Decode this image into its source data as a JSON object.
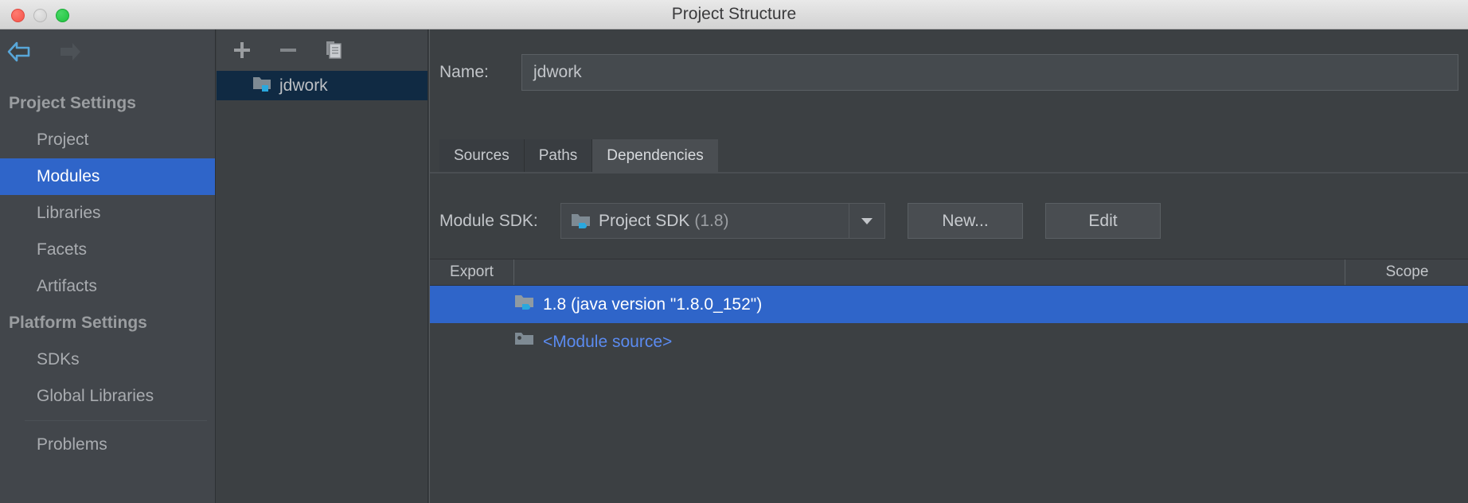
{
  "window": {
    "title": "Project Structure",
    "traffic_lights": [
      "close-button",
      "minimize-button",
      "maximize-button"
    ]
  },
  "nav": {
    "back_icon": "arrow-left-icon",
    "forward_icon": "arrow-right-icon",
    "back_enabled_color": "#58a6d8",
    "forward_disabled_color": "#4d5257"
  },
  "sidebar": {
    "selected": "Modules",
    "selection_color": "#2f65c9",
    "sections": [
      {
        "type": "group",
        "label": "Project Settings"
      },
      {
        "type": "item",
        "label": "Project",
        "selected": false
      },
      {
        "type": "item",
        "label": "Modules",
        "selected": true
      },
      {
        "type": "item",
        "label": "Libraries",
        "selected": false
      },
      {
        "type": "item",
        "label": "Facets",
        "selected": false
      },
      {
        "type": "item",
        "label": "Artifacts",
        "selected": false
      },
      {
        "type": "group",
        "label": "Platform Settings"
      },
      {
        "type": "item",
        "label": "SDKs",
        "selected": false
      },
      {
        "type": "item",
        "label": "Global Libraries",
        "selected": false
      },
      {
        "type": "separator",
        "label": ""
      },
      {
        "type": "item",
        "label": "Problems",
        "selected": false
      }
    ]
  },
  "modules_panel": {
    "toolbar": {
      "add_label": "+",
      "remove_label": "−",
      "copy_icon": "copy-icon"
    },
    "tree": [
      {
        "label": "jdwork",
        "icon": "module-folder-icon",
        "selected": true
      }
    ]
  },
  "detail": {
    "name_label": "Name:",
    "name_value": "jdwork",
    "tabs": [
      {
        "label": "Sources",
        "active": false
      },
      {
        "label": "Paths",
        "active": false
      },
      {
        "label": "Dependencies",
        "active": true
      }
    ],
    "sdk": {
      "label": "Module SDK:",
      "value": "Project SDK",
      "version": "(1.8)",
      "icon": "jdk-folder-icon",
      "dropdown_icon": "chevron-down-icon"
    },
    "buttons": {
      "new_label": "New...",
      "edit_label": "Edit"
    },
    "table": {
      "columns": [
        "Export",
        "",
        "Scope"
      ],
      "rows": [
        {
          "export": "",
          "name": "1.8 (java version \"1.8.0_152\")",
          "icon": "jdk-folder-icon",
          "scope": "",
          "selected": true,
          "link": false
        },
        {
          "export": "",
          "name": "<Module source>",
          "icon": "module-source-icon",
          "scope": "",
          "selected": false,
          "link": true
        }
      ]
    }
  },
  "colors": {
    "window_chrome": "#dcdcdc",
    "panel_bg": "#3c4043",
    "sidebar_bg": "#42464b",
    "selection_blue": "#2f65c9",
    "tree_selection_navy": "#102a43",
    "link_blue": "#5b8bf0",
    "text_primary": "#c8cbcf",
    "text_muted": "#9a9da0"
  }
}
